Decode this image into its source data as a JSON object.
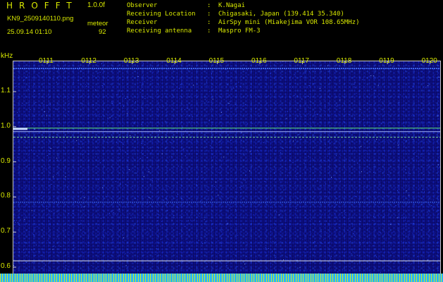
{
  "header": {
    "app_title": "HROFFT",
    "version": "1.0.0f",
    "filename": "KN9_2509140110.png",
    "datetime": "25.09.14 01:10",
    "meteor_label": "meteor",
    "meteor_count": "92",
    "info": [
      {
        "key": "Observer",
        "sep": ":",
        "value": "K.Nagai"
      },
      {
        "key": "Receiving Location",
        "sep": ":",
        "value": "Chigasaki, Japan (139.414 35.340)"
      },
      {
        "key": "Receiver",
        "sep": ":",
        "value": "AirSpy mini (Miakejima VOR 108.65MHz)"
      },
      {
        "key": "Receiving antenna",
        "sep": ":",
        "value": "Maspro FM-3"
      }
    ]
  },
  "chart_data": {
    "type": "heatmap",
    "ylabel": "kHz",
    "ylim": [
      0.6,
      1.17
    ],
    "y_ticks": [
      "1.1",
      "1.0",
      "0.9",
      "0.8",
      "0.7",
      "0.6"
    ],
    "x_ticks": [
      "0111",
      "0112",
      "0113",
      "0114",
      "0115",
      "0116",
      "0117",
      "0118",
      "0119",
      "0120"
    ],
    "signal_lines": [
      {
        "freq_khz": 1.166,
        "color": "#4d7dff"
      },
      {
        "freq_khz": 0.996,
        "color": "#5fe87d"
      },
      {
        "freq_khz": 0.986,
        "color": "#9fb4ff"
      },
      {
        "freq_khz": 0.97,
        "color": "#78d6a0"
      },
      {
        "freq_khz": 0.785,
        "color": "#3f6fff"
      },
      {
        "freq_khz": 0.618,
        "color": "#dcdcdc"
      }
    ],
    "colors": {
      "background": "#0b0c7a",
      "labels": "#d8e800",
      "bottom_bar": "#29b6f6"
    }
  }
}
